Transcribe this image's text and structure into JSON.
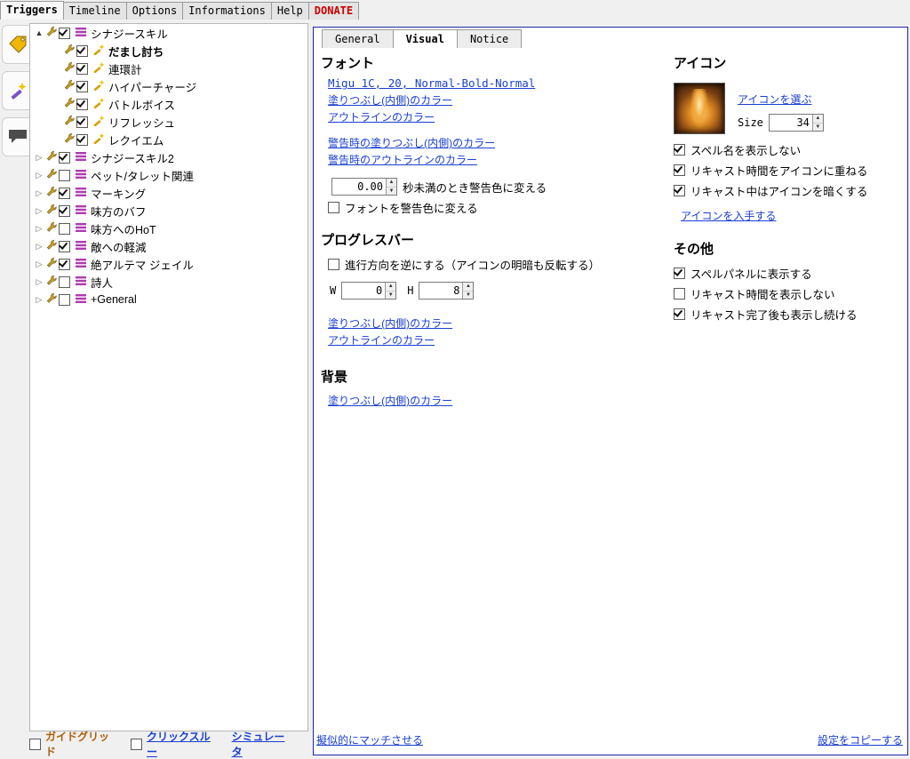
{
  "menu": {
    "tabs": [
      {
        "label": "Triggers",
        "active": true,
        "donate": false
      },
      {
        "label": "Timeline",
        "active": false,
        "donate": false
      },
      {
        "label": "Options",
        "active": false,
        "donate": false
      },
      {
        "label": "Informations",
        "active": false,
        "donate": false
      },
      {
        "label": "Help",
        "active": false,
        "donate": false
      },
      {
        "label": "DONATE",
        "active": false,
        "donate": true
      }
    ]
  },
  "rail": {
    "buttons": [
      {
        "icon": "tag-icon",
        "color": "#f2b705"
      },
      {
        "icon": "magic-wand-icon",
        "color": "#7c53c3"
      },
      {
        "icon": "speech-bubble-icon",
        "color": "#4c4c4c"
      }
    ]
  },
  "tree": {
    "items": [
      {
        "indent": 0,
        "arrow": "open",
        "wrench": true,
        "checked": true,
        "glyph": "list-icon",
        "glyph_color": "#b03ab0",
        "label": "シナジースキル"
      },
      {
        "indent": 1,
        "arrow": "none",
        "wrench": true,
        "checked": true,
        "glyph": "wand-icon",
        "glyph_color": "#d8a000",
        "label": "だまし討ち",
        "bold": true
      },
      {
        "indent": 1,
        "arrow": "none",
        "wrench": true,
        "checked": true,
        "glyph": "wand-icon",
        "glyph_color": "#d8a000",
        "label": "連環計"
      },
      {
        "indent": 1,
        "arrow": "none",
        "wrench": true,
        "checked": true,
        "glyph": "wand-icon",
        "glyph_color": "#d8a000",
        "label": "ハイパーチャージ"
      },
      {
        "indent": 1,
        "arrow": "none",
        "wrench": true,
        "checked": true,
        "glyph": "wand-icon",
        "glyph_color": "#d8a000",
        "label": "バトルボイス"
      },
      {
        "indent": 1,
        "arrow": "none",
        "wrench": true,
        "checked": true,
        "glyph": "wand-icon",
        "glyph_color": "#d8a000",
        "label": "リフレッシュ"
      },
      {
        "indent": 1,
        "arrow": "none",
        "wrench": true,
        "checked": true,
        "glyph": "wand-icon",
        "glyph_color": "#d8a000",
        "label": "レクイエム"
      },
      {
        "indent": 0,
        "arrow": "closed",
        "wrench": true,
        "checked": true,
        "glyph": "list-icon",
        "glyph_color": "#b03ab0",
        "label": "シナジースキル2"
      },
      {
        "indent": 0,
        "arrow": "closed",
        "wrench": true,
        "checked": false,
        "glyph": "list-icon",
        "glyph_color": "#b03ab0",
        "label": "ペット/タレット関連"
      },
      {
        "indent": 0,
        "arrow": "closed",
        "wrench": true,
        "checked": true,
        "glyph": "list-icon",
        "glyph_color": "#b03ab0",
        "label": "マーキング"
      },
      {
        "indent": 0,
        "arrow": "closed",
        "wrench": true,
        "checked": true,
        "glyph": "list-icon",
        "glyph_color": "#b03ab0",
        "label": "味方のバフ"
      },
      {
        "indent": 0,
        "arrow": "closed",
        "wrench": true,
        "checked": false,
        "glyph": "list-icon",
        "glyph_color": "#b03ab0",
        "label": "味方へのHoT"
      },
      {
        "indent": 0,
        "arrow": "closed",
        "wrench": true,
        "checked": true,
        "glyph": "list-icon",
        "glyph_color": "#b03ab0",
        "label": "敵への軽減"
      },
      {
        "indent": 0,
        "arrow": "closed",
        "wrench": true,
        "checked": true,
        "glyph": "list-icon",
        "glyph_color": "#b03ab0",
        "label": "絶アルテマ ジェイル"
      },
      {
        "indent": 0,
        "arrow": "closed",
        "wrench": true,
        "checked": false,
        "glyph": "list-icon",
        "glyph_color": "#b03ab0",
        "label": "詩人"
      },
      {
        "indent": 0,
        "arrow": "closed",
        "wrench": true,
        "checked": false,
        "glyph": "list-icon",
        "glyph_color": "#b03ab0",
        "label": "+General"
      }
    ],
    "footer": {
      "guide_grid_label": "ガイドグリッド",
      "guide_grid_checked": false,
      "click_through_label": "クリックスルー",
      "click_through_checked": false,
      "simulator_label": "シミュレータ"
    }
  },
  "subtabs": [
    {
      "label": "General",
      "active": false
    },
    {
      "label": "Visual",
      "active": true
    },
    {
      "label": "Notice",
      "active": false
    }
  ],
  "visual": {
    "font_section_title": "フォント",
    "font_value": "Migu 1C, 20, Normal-Bold-Normal",
    "font_links": [
      "塗りつぶし(内側)のカラー",
      "アウトラインのカラー"
    ],
    "warn_links": [
      "警告時の塗りつぶし(内側)のカラー",
      "警告時のアウトラインのカラー"
    ],
    "warn_seconds_value": "0.00",
    "warn_seconds_label": "秒未満のとき警告色に変える",
    "font_warn_color_label": "フォントを警告色に変える",
    "font_warn_color_checked": false,
    "progress_section_title": "プログレスバー",
    "progress_reverse_label": "進行方向を逆にする（アイコンの明暗も反転する）",
    "progress_reverse_checked": false,
    "w_label": "W",
    "w_value": "0",
    "h_label": "H",
    "h_value": "8",
    "progress_links": [
      "塗りつぶし(内側)のカラー",
      "アウトラインのカラー"
    ],
    "background_section_title": "背景",
    "background_links": [
      "塗りつぶし(内側)のカラー"
    ],
    "icon_section_title": "アイコン",
    "icon_choose_link": "アイコンを選ぶ",
    "size_label": "Size",
    "size_value": "34",
    "icon_checks": [
      {
        "label": "スペル名を表示しない",
        "checked": true
      },
      {
        "label": "リキャスト時間をアイコンに重ねる",
        "checked": true
      },
      {
        "label": "リキャスト中はアイコンを暗くする",
        "checked": true
      }
    ],
    "icon_get_link": "アイコンを入手する",
    "other_section_title": "その他",
    "other_checks": [
      {
        "label": "スペルパネルに表示する",
        "checked": true
      },
      {
        "label": "リキャスト時間を表示しない",
        "checked": false
      },
      {
        "label": "リキャスト完了後も表示し続ける",
        "checked": true
      }
    ]
  },
  "footer": {
    "match_link": "擬似的にマッチさせる",
    "copy_link": "設定をコピーする"
  }
}
